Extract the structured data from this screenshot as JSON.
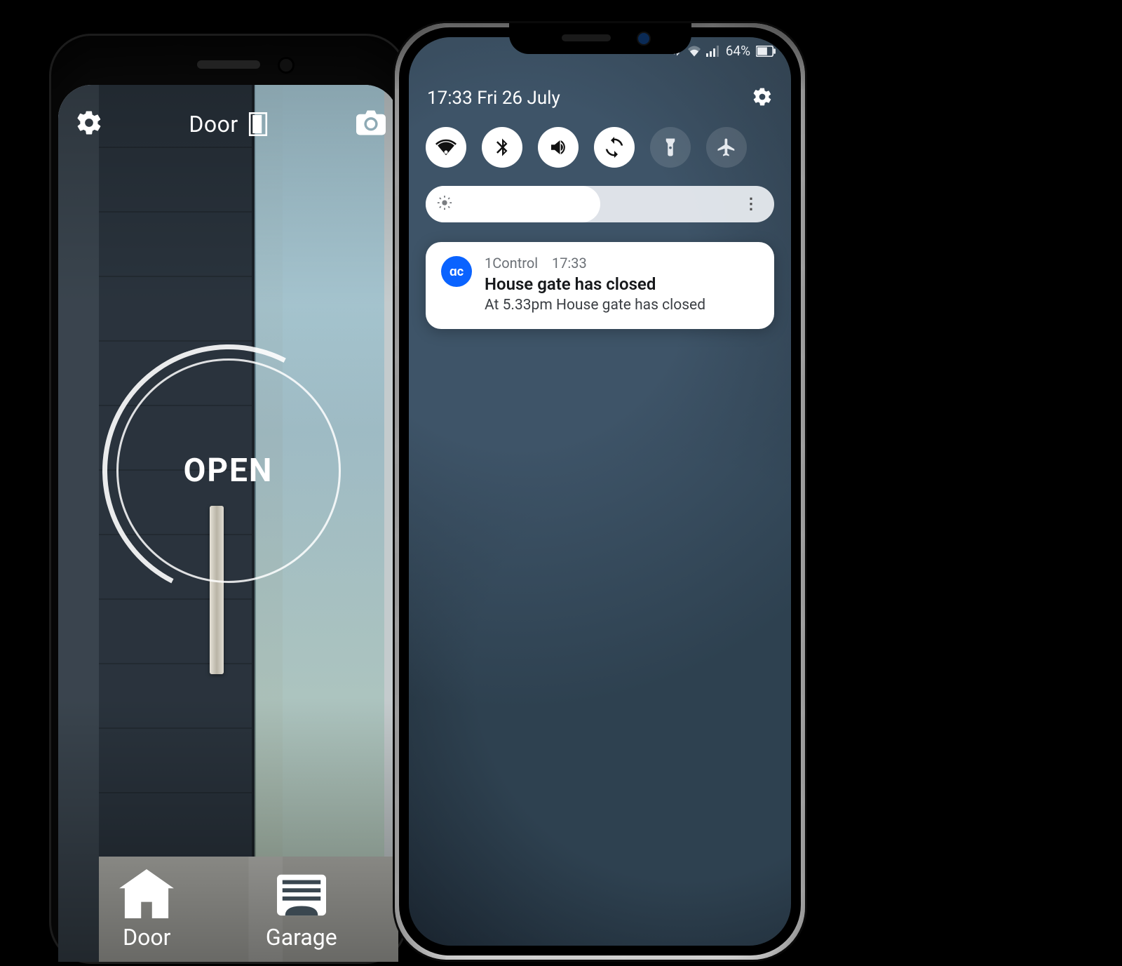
{
  "left_app": {
    "header_title": "Door",
    "open_label": "OPEN",
    "nav": {
      "door_label": "Door",
      "garage_label": "Garage"
    }
  },
  "right_panel": {
    "status_bar": {
      "battery_text": "64%"
    },
    "datetime": "17:33  Fri 26 July",
    "quick_settings": [
      "wifi",
      "bluetooth",
      "sound",
      "rotate",
      "torch",
      "airplane"
    ],
    "brightness_percent": 50,
    "notification": {
      "app_badge": "ɑc",
      "app_name": "1Control",
      "time": "17:33",
      "title": "House gate has closed",
      "body": "At 5.33pm House gate has closed"
    }
  }
}
